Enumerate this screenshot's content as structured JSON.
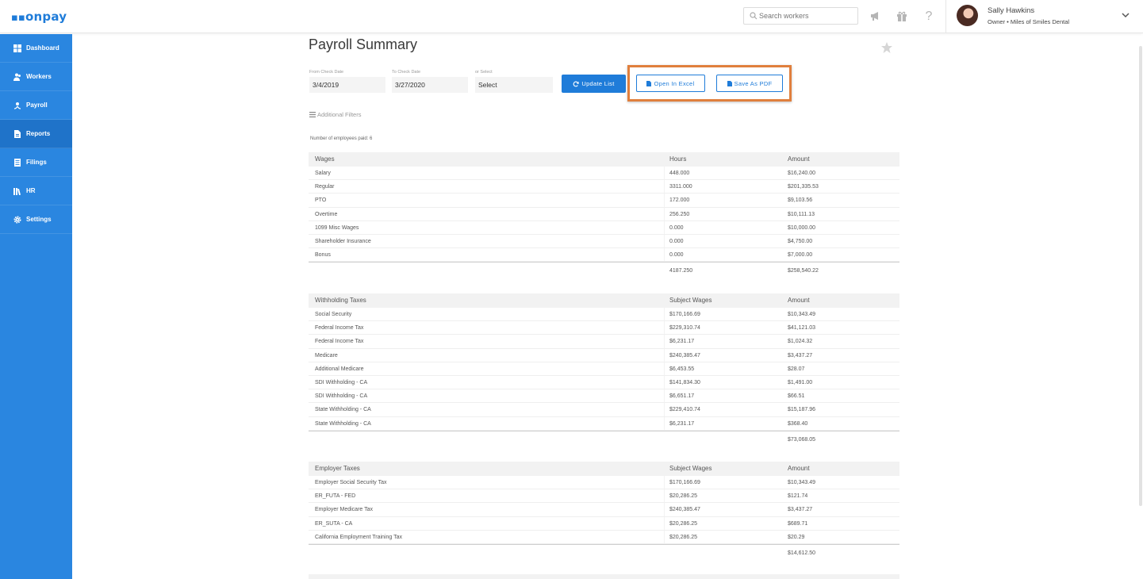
{
  "topbar": {
    "logo": "onpay",
    "search_placeholder": "Search workers",
    "user_name": "Sally Hawkins",
    "user_role": "Owner • Miles of Smiles Dental"
  },
  "sidebar": {
    "items": [
      {
        "label": "Dashboard",
        "icon": "dashboard-icon"
      },
      {
        "label": "Workers",
        "icon": "workers-icon"
      },
      {
        "label": "Payroll",
        "icon": "payroll-icon"
      },
      {
        "label": "Reports",
        "icon": "reports-icon",
        "active": true
      },
      {
        "label": "Filings",
        "icon": "filings-icon"
      },
      {
        "label": "HR",
        "icon": "hr-icon"
      },
      {
        "label": "Settings",
        "icon": "gear-icon"
      }
    ]
  },
  "page": {
    "title": "Payroll Summary"
  },
  "filters": {
    "from_label": "From Check Date",
    "from_value": "3/4/2019",
    "to_label": "To Check Date",
    "to_value": "3/27/2020",
    "select_label": "or Select",
    "select_value": "Select",
    "update_label": "Update List",
    "excel_label": "Open In Excel",
    "pdf_label": "Save As PDF",
    "additional_filters": "Additional Filters"
  },
  "summary": {
    "employees_paid": "Number of employees paid: 6"
  },
  "wages": {
    "headers": [
      "Wages",
      "Hours",
      "Amount"
    ],
    "rows": [
      [
        "Salary",
        "448.000",
        "$16,240.00"
      ],
      [
        "Regular",
        "3311.000",
        "$201,335.53"
      ],
      [
        "PTO",
        "172.000",
        "$9,103.56"
      ],
      [
        "Overtime",
        "256.250",
        "$10,111.13"
      ],
      [
        "1099 Misc Wages",
        "0.000",
        "$10,000.00"
      ],
      [
        "Shareholder Insurance",
        "0.000",
        "$4,750.00"
      ],
      [
        "Bonus",
        "0.000",
        "$7,000.00"
      ]
    ],
    "total_hours": "4187.250",
    "total_amount": "$258,540.22"
  },
  "withholding": {
    "headers": [
      "Withholding Taxes",
      "Subject Wages",
      "Amount"
    ],
    "rows": [
      [
        "Social Security",
        "$170,166.69",
        "$10,343.49"
      ],
      [
        "Federal Income Tax",
        "$229,310.74",
        "$41,121.03"
      ],
      [
        "Federal Income Tax",
        "$6,231.17",
        "$1,024.32"
      ],
      [
        "Medicare",
        "$240,385.47",
        "$3,437.27"
      ],
      [
        "Additional Medicare",
        "$6,453.55",
        "$28.07"
      ],
      [
        "SDI Withholding - CA",
        "$141,834.30",
        "$1,491.00"
      ],
      [
        "SDI Withholding - CA",
        "$6,651.17",
        "$66.51"
      ],
      [
        "State Withholding - CA",
        "$229,410.74",
        "$15,187.96"
      ],
      [
        "State Withholding - CA",
        "$6,231.17",
        "$368.40"
      ]
    ],
    "total_amount": "$73,068.05"
  },
  "employer": {
    "headers": [
      "Employer Taxes",
      "Subject Wages",
      "Amount"
    ],
    "rows": [
      [
        "Employer Social Security Tax",
        "$170,166.69",
        "$10,343.49"
      ],
      [
        "ER_FUTA - FED",
        "$20,286.25",
        "$121.74"
      ],
      [
        "Employer Medicare Tax",
        "$240,385.47",
        "$3,437.27"
      ],
      [
        "ER_SUTA - CA",
        "$20,286.25",
        "$689.71"
      ],
      [
        "California Employment Training Tax",
        "$20,286.25",
        "$20.29"
      ]
    ],
    "total_amount": "$14,612.50"
  },
  "colors": {
    "primary": "#1f7cd9",
    "sidebar": "#2a86e0",
    "highlight": "#e07f3d"
  }
}
